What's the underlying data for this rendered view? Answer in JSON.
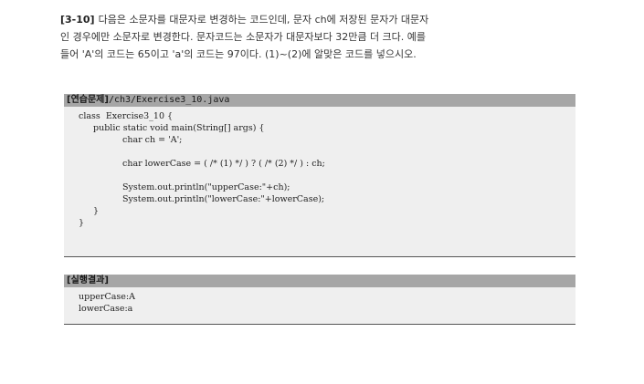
{
  "problem": {
    "number": "[3-10]",
    "line1": "다음은 소문자를 대문자로 변경하는 코드인데, 문자 ch에 저장된 문자가 대문자",
    "line2": "인 경우에만 소문자로 변경한다. 문자코드는 소문자가 대문자보다 32만큼 더 크다. 예를",
    "line3": "들어 'A'의 코드는 65이고 'a'의 코드는 97이다. (1)~(2)에 알맞은 코드를 넣으시오."
  },
  "exercise": {
    "header_label": "[연습문제]",
    "header_path": "/ch3/Exercise3_10.java",
    "lines": [
      "class  Exercise3_10 {",
      "public static void main(String[] args) {",
      "char ch = 'A';",
      "",
      "char lowerCase = ( /* (1) */ ) ? ( /* (2) */ ) : ch;",
      "",
      "System.out.println(\"upperCase:\"+ch);",
      "System.out.println(\"lowerCase:\"+lowerCase);",
      "}",
      "}"
    ]
  },
  "result": {
    "header_label": "[실행결과]",
    "lines": [
      "upperCase:A",
      "lowerCase:a"
    ]
  }
}
